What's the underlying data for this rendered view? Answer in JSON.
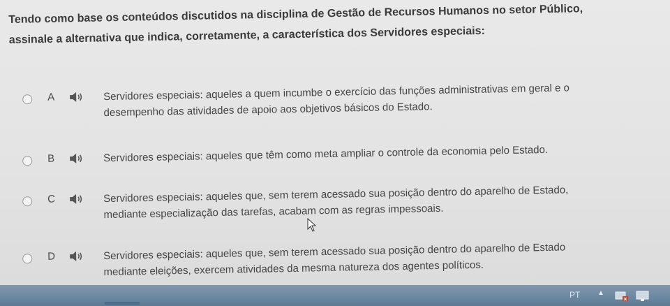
{
  "question": {
    "line1": "Tendo como base os conteúdos discutidos na disciplina de Gestão de Recursos Humanos no setor Público,",
    "line2": "assinale a alternativa que indica, corretamente, a característica dos Servidores especiais:"
  },
  "options": [
    {
      "letter": "A",
      "line1": "Servidores especiais: aqueles a quem incumbe o exercício das funções administrativas em geral e o",
      "line2": "desempenho das atividades de apoio aos objetivos básicos do Estado."
    },
    {
      "letter": "B",
      "line1": "Servidores especiais: aqueles que têm como meta ampliar o controle da economia pelo Estado.",
      "line2": ""
    },
    {
      "letter": "C",
      "line1": "Servidores especiais: aqueles que, sem terem acessado sua posição dentro do aparelho de Estado,",
      "line2": "mediante especialização das tarefas, acabam com as regras impessoais."
    },
    {
      "letter": "D",
      "line1": "Servidores especiais: aqueles que, sem terem acessado sua posição dentro do aparelho de Estado",
      "line2": "mediante eleições, exercem atividades da mesma natureza dos agentes políticos."
    }
  ],
  "taskbar": {
    "language": "PT",
    "tray_icons": [
      "tray-arrow-icon",
      "network-icon",
      "monitor-icon"
    ]
  }
}
